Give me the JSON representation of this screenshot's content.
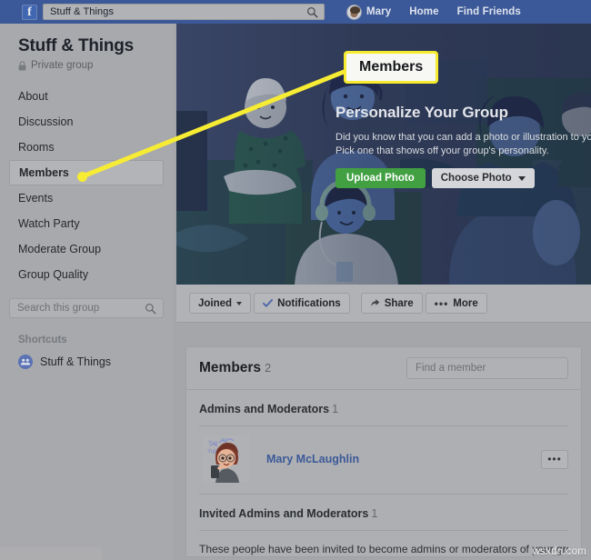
{
  "topbar": {
    "logo": "f",
    "search": {
      "value": "Stuff & Things",
      "placeholder": "Search",
      "icon": "search-icon"
    },
    "user": {
      "name": "Mary",
      "avatar": "user-avatar"
    },
    "links": [
      {
        "label": "Home"
      },
      {
        "label": "Find Friends"
      }
    ]
  },
  "sidebar": {
    "group_name": "Stuff & Things",
    "privacy": {
      "icon": "lock-icon",
      "label": "Private group"
    },
    "nav": [
      {
        "label": "About",
        "active": false
      },
      {
        "label": "Discussion",
        "active": false
      },
      {
        "label": "Rooms",
        "active": false
      },
      {
        "label": "Members",
        "active": true
      },
      {
        "label": "Events",
        "active": false
      },
      {
        "label": "Watch Party",
        "active": false
      },
      {
        "label": "Moderate Group",
        "active": false
      },
      {
        "label": "Group Quality",
        "active": false
      }
    ],
    "group_search": {
      "placeholder": "Search this group",
      "icon": "search-icon"
    },
    "shortcuts_header": "Shortcuts",
    "shortcuts": [
      {
        "label": "Stuff & Things",
        "icon": "group-icon"
      }
    ]
  },
  "cover": {
    "promo_title": "Personalize Your Group",
    "promo_line1": "Did you know that you can add a photo or illustration to your group?",
    "promo_line2": "Pick one that shows off your group's personality.",
    "upload_button": "Upload Photo",
    "choose_button": "Choose Photo"
  },
  "tabbar": {
    "buttons": [
      {
        "label": "Joined",
        "icon": "chevron-down-icon"
      },
      {
        "label": "Notifications",
        "icon": "check-icon"
      },
      {
        "label": "Share",
        "icon": "share-icon"
      },
      {
        "label": "More",
        "icon": "ellipsis-icon"
      }
    ]
  },
  "members_card": {
    "title": "Members",
    "count": "2",
    "find_placeholder": "Find a member",
    "sections": [
      {
        "heading": "Admins and Moderators",
        "count": "1",
        "members": [
          {
            "name": "Mary McLaughlin",
            "avatar": "member-avatar",
            "menu_icon": "ellipsis-icon"
          }
        ]
      },
      {
        "heading": "Invited Admins and Moderators",
        "count": "1",
        "description": "These people have been invited to become admins or moderators of your group but"
      }
    ]
  },
  "callout": {
    "label": "Members"
  },
  "watermark": "wsxdn.com",
  "statusbar": "",
  "colors": {
    "fb_blue": "#3b5998",
    "link_blue": "#3b5998",
    "green": "#42a043",
    "highlight_yellow": "#f7eb2f",
    "page_bg": "#a5a6a9"
  }
}
